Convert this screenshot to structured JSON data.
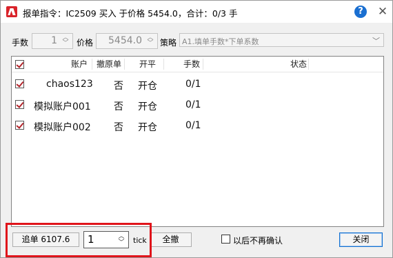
{
  "window": {
    "title": "报单指令：IC2509 买入 于价格 5454.0，合计：0/3 手",
    "help_label": "?",
    "close_label": "✕"
  },
  "params": {
    "lots_label": "手数",
    "lots_value": "1",
    "price_label": "价格",
    "price_value": "5454.0",
    "strategy_label": "策略",
    "strategy_value": "A1.填单手数*下单系数"
  },
  "table": {
    "headers": [
      "账户",
      "撤原单",
      "开平",
      "手数",
      "状态"
    ],
    "rows": [
      {
        "account": "chaos123",
        "cancel_original": "否",
        "open_close": "开仓",
        "lots": "0/1",
        "status": "",
        "checked": true
      },
      {
        "account": "模拟账户001",
        "cancel_original": "否",
        "open_close": "开仓",
        "lots": "0/1",
        "status": "",
        "checked": true
      },
      {
        "account": "模拟账户002",
        "cancel_original": "否",
        "open_close": "开仓",
        "lots": "0/1",
        "status": "",
        "checked": true
      }
    ]
  },
  "bottom": {
    "chase_button": "追单 6107.6",
    "tick_value": "1",
    "tick_label": "tick",
    "cancel_all_button": "全撤",
    "no_confirm_label": "以后不再确认",
    "no_confirm_checked": false,
    "close_button": "关闭"
  },
  "colors": {
    "accent_red": "#e0131a",
    "brand_icon": "#d9232a",
    "help_blue": "#1a6fd1"
  }
}
